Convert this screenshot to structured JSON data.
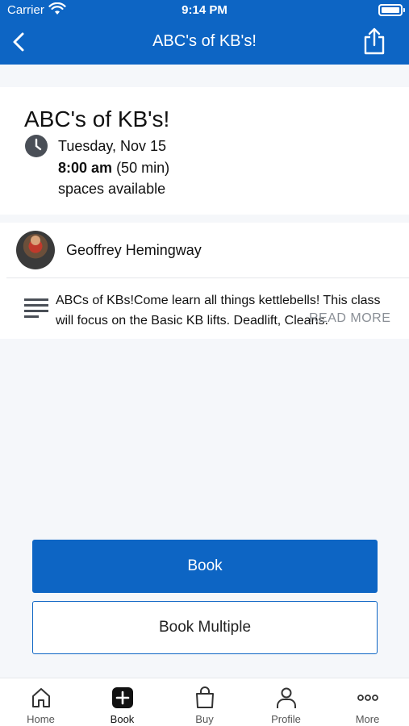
{
  "status_bar": {
    "carrier": "Carrier",
    "time": "9:14 PM"
  },
  "header": {
    "title": "ABC's of KB's!",
    "back_icon": "chevron-left-icon",
    "share_icon": "share-icon",
    "color": "#0d65c4"
  },
  "class_info": {
    "name": "ABC's of KB's!",
    "date": "Tuesday, Nov 15",
    "start_time": "8:00 am",
    "duration": "(50 min)",
    "availability": "spaces available"
  },
  "instructor": {
    "name": "Geoffrey Hemingway"
  },
  "description": {
    "text": "ABCs of KBs!Come learn all things kettlebells! This class will focus on the Basic KB lifts. Deadlift, Cleans.",
    "read_more": "READ MORE"
  },
  "actions": {
    "book_label": "Book",
    "book_multiple_label": "Book Multiple"
  },
  "tabbar": {
    "items": [
      {
        "label": "Home",
        "icon": "home-icon"
      },
      {
        "label": "Book",
        "icon": "plus-square-icon",
        "active": true
      },
      {
        "label": "Buy",
        "icon": "shopping-bag-icon"
      },
      {
        "label": "Profile",
        "icon": "person-icon"
      },
      {
        "label": "More",
        "icon": "more-dots-icon"
      }
    ]
  }
}
